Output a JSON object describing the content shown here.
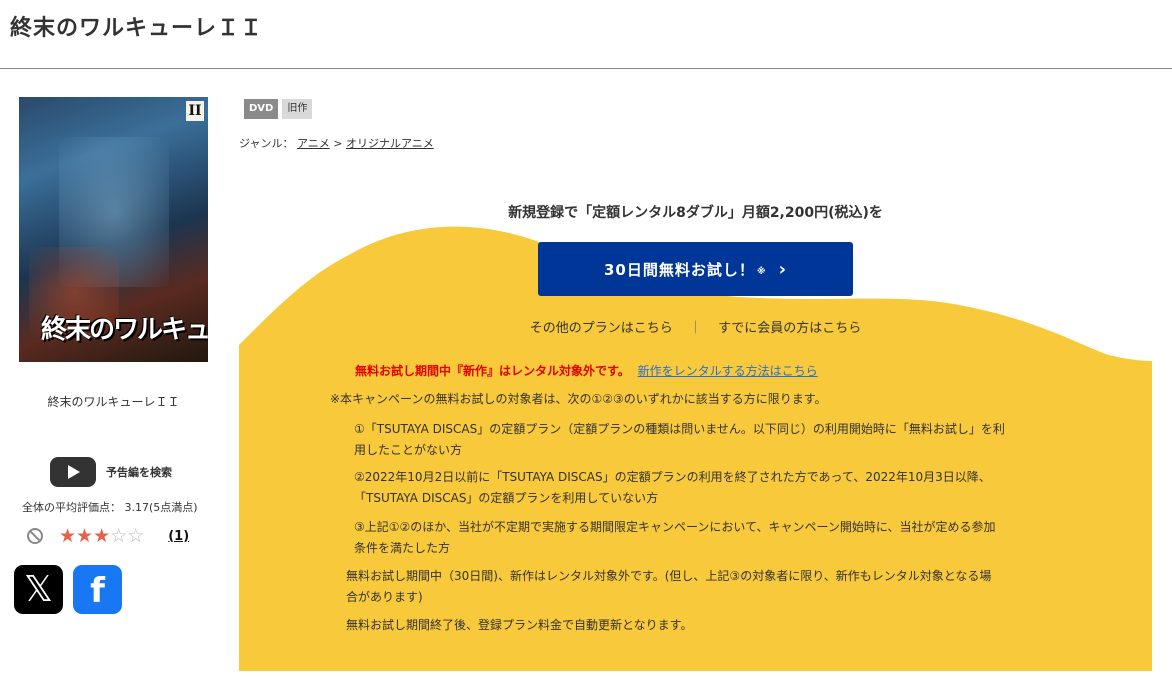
{
  "page": {
    "title": "終末のワルキューレＩＩ"
  },
  "product": {
    "cover_volume_mark": "II",
    "cover_logo_text": "終末のワルキューレII",
    "caption": "終末のワルキューレＩＩ",
    "tags": [
      "DVD",
      "旧作"
    ],
    "genre": {
      "label": "ジャンル：",
      "items": [
        "アニメ",
        "オリジナルアニメ"
      ],
      "separator": ">"
    }
  },
  "sidebar": {
    "trailer_label": "予告編を検索",
    "avg_rating_text": "全体の平均評価点： 3.17(5点満点)",
    "rating": {
      "value": 3.17,
      "max": 5,
      "full_stars": 3,
      "empty_stars": 2,
      "count_text": "(1)"
    },
    "share": [
      {
        "name": "X",
        "glyph": "𝕏"
      },
      {
        "name": "Facebook",
        "glyph": "f"
      }
    ]
  },
  "promo": {
    "headline": "新規登録で「定額レンタル8ダブル」月額2,200円(税込)を",
    "button_label": "30日間無料お試し！",
    "button_mark": "※",
    "button_chevron": "›",
    "other_plans_link": "その他のプランはこちら",
    "separator": "｜",
    "member_link": "すでに会員の方はこちら",
    "bg_color": "#f8c93a",
    "button_color": "#003697"
  },
  "notes": {
    "red_notice": "無料お試し期間中『新作』はレンタル対象外です。",
    "red_notice_link": "新作をレンタルする方法はこちら",
    "campaign_intro": "※本キャンペーンの無料お試しの対象者は、次の①②③のいずれかに該当する方に限ります。",
    "cond1_line1": "①「TSUTAYA DISCAS」の定額プラン（定額プランの種類は問いません。以下同じ）の利用開始時に「無料お試し」を利",
    "cond1_line2": "用したことがない方",
    "cond2_line1": "②2022年10月2日以前に「TSUTAYA DISCAS」の定額プランの利用を終了された方であって、2022年10月3日以降、",
    "cond2_line2": "「TSUTAYA DISCAS」の定額プランを利用していない方",
    "cond3_line1": "③上記①②のほか、当社が不定期で実施する期間限定キャンペーンにおいて、キャンペーン開始時に、当社が定める参加",
    "cond3_line2": "条件を満たした方",
    "trial_line1": "無料お試し期間中（30日間)、新作はレンタル対象外です。(但し、上記③の対象者に限り、新作もレンタル対象となる場",
    "trial_line2": "合があります)",
    "auto_renew": "無料お試し期間終了後、登録プラン料金で自動更新となります。"
  }
}
